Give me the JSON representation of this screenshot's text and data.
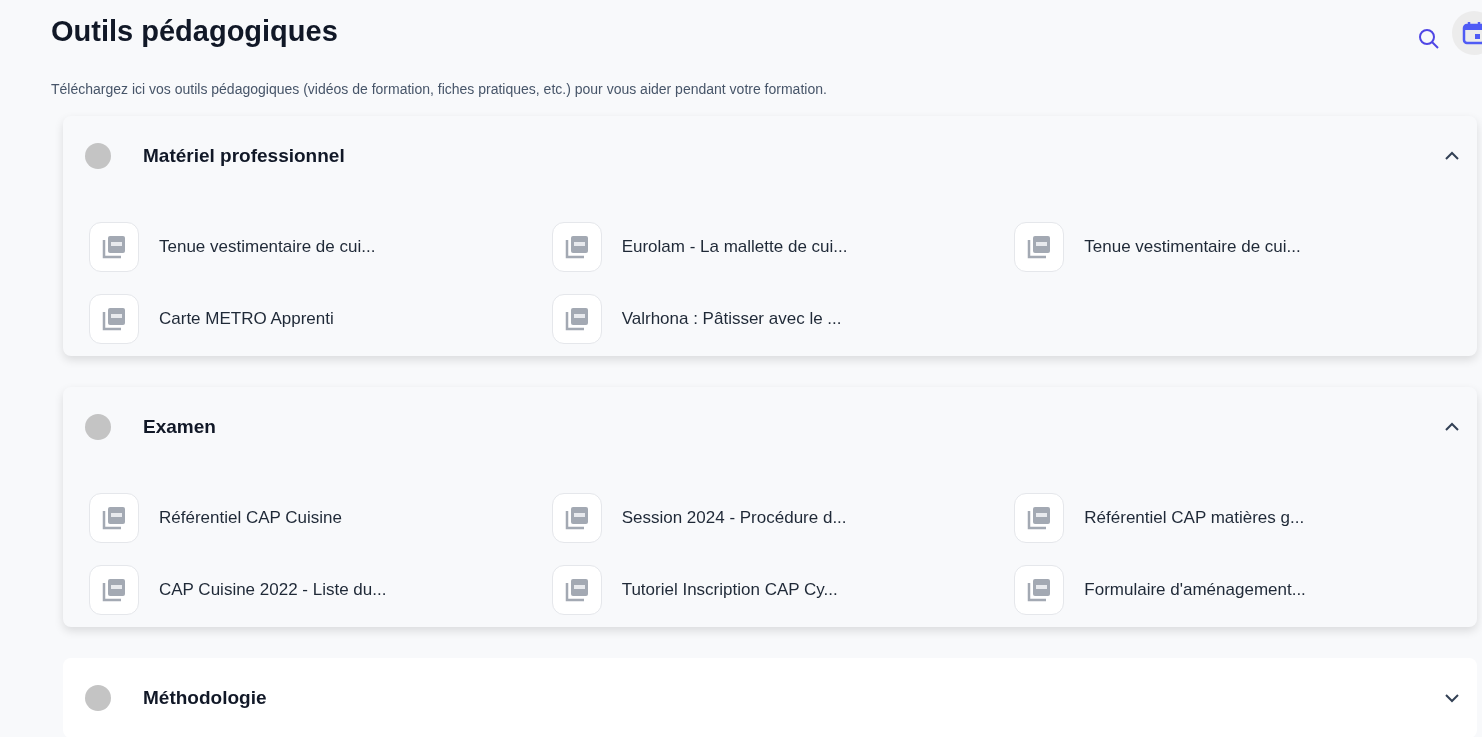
{
  "title": "Outils pédagogiques",
  "description": "Téléchargez ici vos outils pédagogiques (vidéos de formation, fiches pratiques, etc.) pour vous aider pendant votre formation.",
  "sections": [
    {
      "title": "Matériel professionnel",
      "expanded": true,
      "files": [
        "Tenue vestimentaire de cui...",
        "Eurolam - La mallette de cui...",
        "Tenue vestimentaire de cui...",
        "Carte METRO Apprenti",
        "Valrhona : Pâtisser avec le ..."
      ]
    },
    {
      "title": "Examen",
      "expanded": true,
      "files": [
        "Référentiel CAP Cuisine",
        "Session 2024 - Procédure d...",
        "Référentiel CAP matières g...",
        "CAP Cuisine 2022 - Liste du...",
        "Tutoriel Inscription CAP Cy...",
        "Formulaire d'aménagement..."
      ]
    },
    {
      "title": "Méthodologie",
      "expanded": false
    }
  ]
}
